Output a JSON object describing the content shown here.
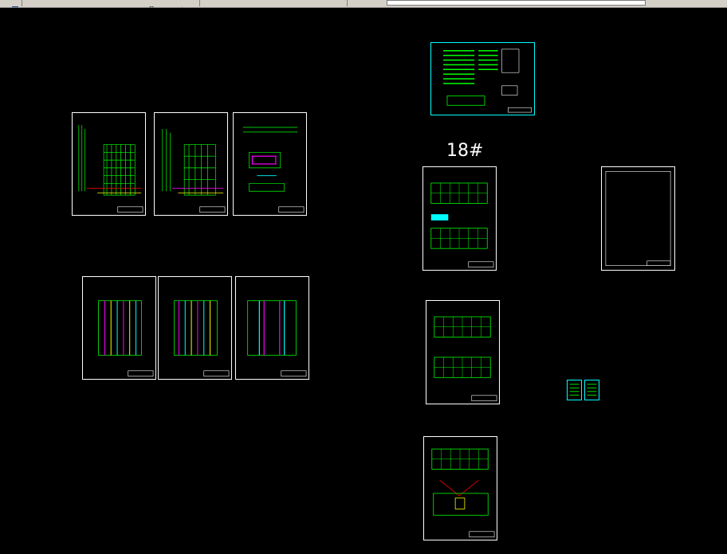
{
  "toolbar": {
    "icons": [
      "open-icon",
      "save-icon",
      "print-icon",
      "undo-icon",
      "redo-icon",
      "pan-icon",
      "zoom-icon",
      "zoom-window-icon",
      "properties-icon",
      "design-center-icon",
      "tool-palette-icon",
      "sheet-set-icon",
      "markup-icon",
      "calculator-icon",
      "help-icon",
      "layer-icon",
      "layer-previous-icon",
      "layer-state-icon"
    ]
  },
  "canvas": {
    "building_label": "18#"
  },
  "colors": {
    "background": "#000000",
    "sheet_border": "#ffffff",
    "line_green": "#00ff00",
    "line_cyan": "#00ffff",
    "line_magenta": "#ff00ff",
    "line_yellow": "#ffff00",
    "line_red": "#ff0000"
  }
}
